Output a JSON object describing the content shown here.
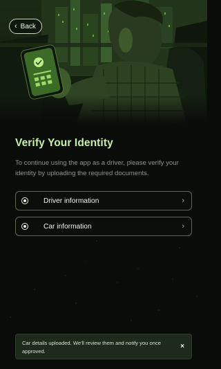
{
  "header": {
    "back_label": "Back"
  },
  "verify": {
    "title": "Verify Your Identity",
    "description": "To continue using the app as a driver, please verify your identity by uploading the required documents."
  },
  "options": [
    {
      "label": "Driver information"
    },
    {
      "label": "Car information"
    }
  ],
  "toast": {
    "message": "Car details uploaded. We'll review them and notify you once approved.",
    "close_symbol": "×"
  },
  "colors": {
    "accent": "#c9f0a8",
    "background": "#0a0c0a",
    "toast_bg": "#1e2a1b"
  }
}
